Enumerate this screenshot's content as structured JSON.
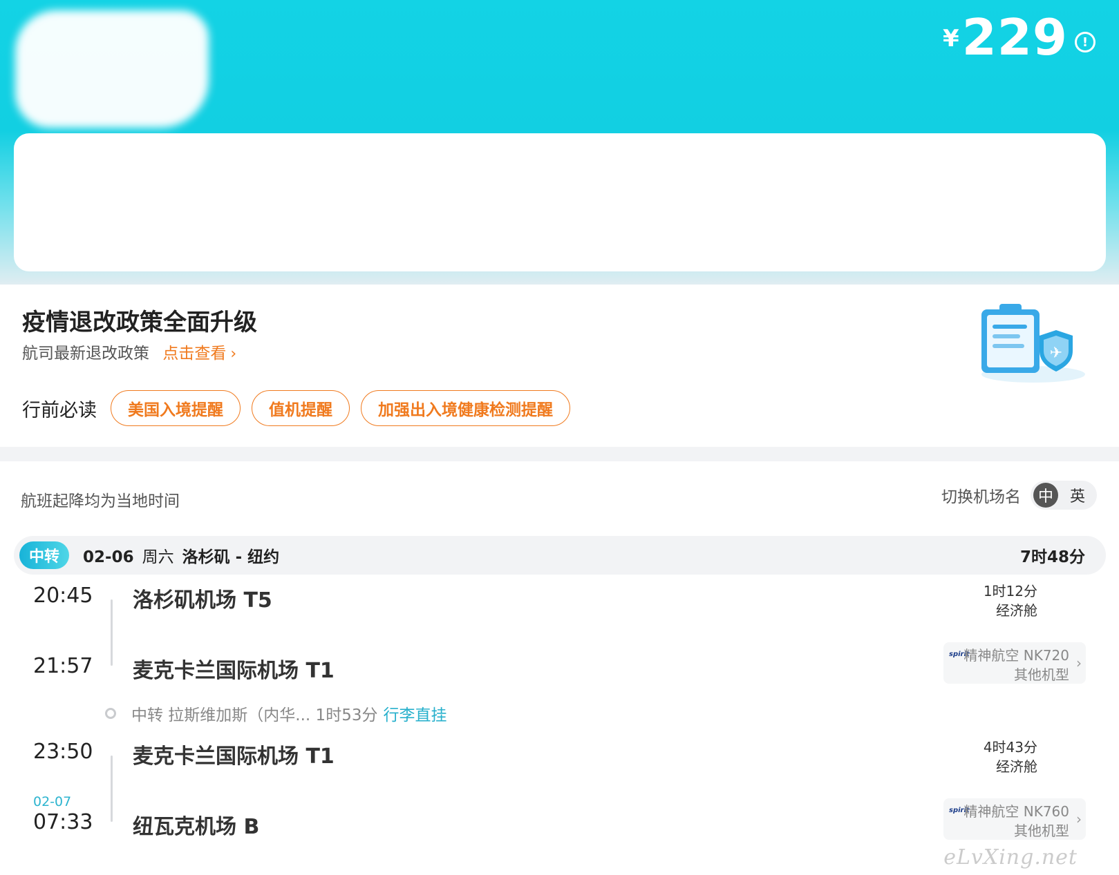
{
  "header": {
    "price_currency": "¥",
    "price_amount": "229",
    "info_icon": "info-circle-icon"
  },
  "policy": {
    "title": "疫情退改政策全面升级",
    "subtitle": "航司最新退改政策",
    "link": "点击查看",
    "reading_label": "行前必读",
    "tags": [
      "美国入境提醒",
      "值机提醒",
      "加强出入境健康检测提醒"
    ]
  },
  "flights": {
    "local_time_note": "航班起降均为当地时间",
    "switch_label": "切换机场名",
    "switch_options": [
      "中",
      "英"
    ],
    "route": {
      "badge": "中转",
      "date": "02-06",
      "weekday": "周六",
      "cities": "洛杉矶 - 纽约",
      "duration": "7时48分"
    },
    "segments": [
      {
        "dep_time": "20:45",
        "dep_airport": "洛杉矶机场 T5",
        "arr_time": "21:57",
        "arr_airport": "麦克卡兰国际机场 T1",
        "flight_duration": "1时12分",
        "cabin": "经济舱",
        "airline": "精神航空 NK720",
        "aircraft": "其他机型",
        "airline_logo": "spirit"
      },
      {
        "dep_time": "23:50",
        "dep_airport": "麦克卡兰国际机场 T1",
        "arr_date": "02-07",
        "arr_time": "07:33",
        "arr_airport": "纽瓦克机场 B",
        "flight_duration": "4时43分",
        "cabin": "经济舱",
        "airline": "精神航空 NK760",
        "aircraft": "其他机型",
        "airline_logo": "spirit"
      }
    ],
    "transfer": {
      "text": "中转 拉斯维加斯（内华... 1时53分",
      "link": "行李直挂"
    }
  },
  "watermark": "eLvXing.net",
  "colors": {
    "accent_cyan": "#13d3e5",
    "orange": "#f07a1e",
    "teal_link": "#27b0cc"
  }
}
